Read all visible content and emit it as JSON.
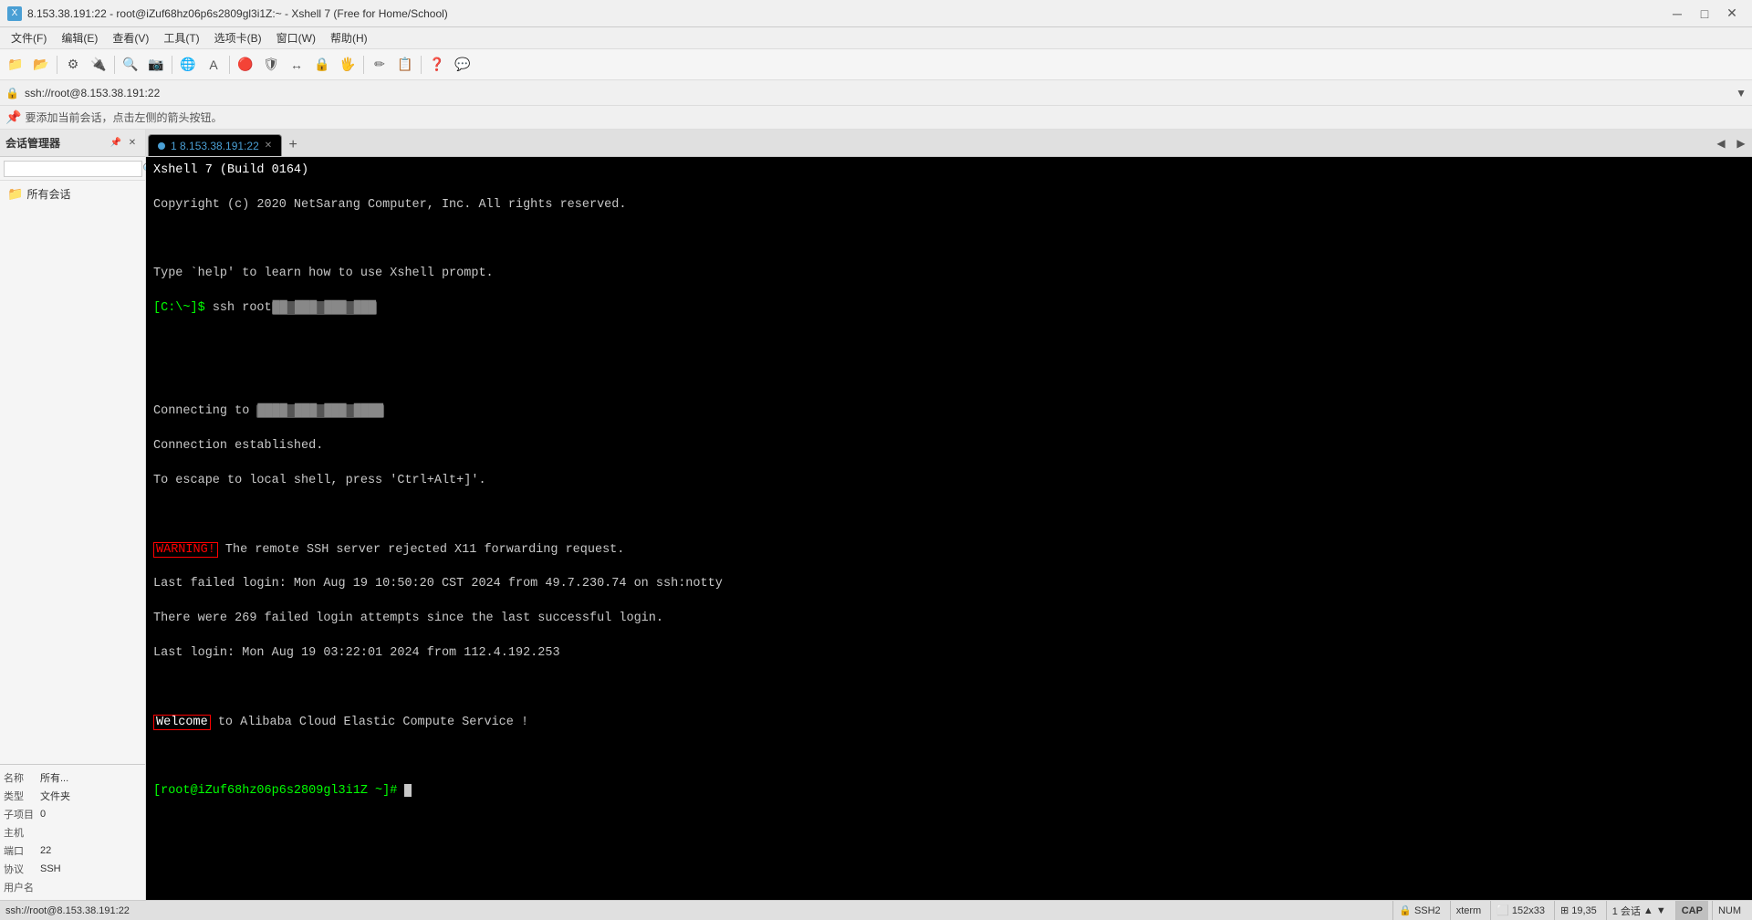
{
  "titlebar": {
    "title": "8.153.38.191:22 - root@iZuf68hz06p6s2809gl3i1Z:~ - Xshell 7 (Free for Home/School)",
    "minimize_label": "─",
    "maximize_label": "□",
    "close_label": "✕"
  },
  "menubar": {
    "items": [
      "文件(F)",
      "编辑(E)",
      "查看(V)",
      "工具(T)",
      "选项卡(B)",
      "窗口(W)",
      "帮助(H)"
    ]
  },
  "addressbar": {
    "address": "ssh://root@8.153.38.191:22",
    "lock_icon": "🔒"
  },
  "hintbar": {
    "text": "要添加当前会话，点击左侧的箭头按钮。",
    "icon": "📌"
  },
  "sidebar": {
    "title": "会话管理器",
    "all_sessions_label": "所有会话",
    "search_placeholder": "",
    "props": {
      "name_label": "名称",
      "name_value": "所有...",
      "type_label": "类型",
      "type_value": "文件夹",
      "subitem_label": "子项目",
      "subitem_value": "0",
      "host_label": "主机",
      "host_value": "",
      "port_label": "端口",
      "port_value": "22",
      "protocol_label": "协议",
      "protocol_value": "SSH",
      "username_label": "用户名",
      "username_value": ""
    }
  },
  "tabs": {
    "active_tab": {
      "label": "1 8.153.38.191:22",
      "dot_color": "#4a9fd4"
    },
    "add_label": "+"
  },
  "terminal": {
    "lines": [
      {
        "id": "l1",
        "text": "Xshell 7 (Build 0164)",
        "color": "white"
      },
      {
        "id": "l2",
        "text": "Copyright (c) 2020 NetSarang Computer, Inc. All rights reserved.",
        "color": "normal"
      },
      {
        "id": "l3",
        "text": "",
        "color": "normal"
      },
      {
        "id": "l4",
        "text": "Type `help' to learn how to use Xshell prompt.",
        "color": "normal"
      },
      {
        "id": "l5",
        "text": "[C:\\~]$ ssh root@BLURRED",
        "color": "green_prompt"
      },
      {
        "id": "l6",
        "text": "",
        "color": "normal"
      },
      {
        "id": "l7",
        "text": "",
        "color": "normal"
      },
      {
        "id": "l8",
        "text": "Connecting to BLURRED_IP",
        "color": "normal"
      },
      {
        "id": "l9",
        "text": "Connection established.",
        "color": "normal"
      },
      {
        "id": "l10",
        "text": "To escape to local shell, press 'Ctrl+Alt+]'.",
        "color": "normal"
      },
      {
        "id": "l11",
        "text": "",
        "color": "normal"
      },
      {
        "id": "l12",
        "text": "WARNING! The remote SSH server rejected X11 forwarding request.",
        "color": "warning"
      },
      {
        "id": "l13",
        "text": "Last failed login: Mon Aug 19 10:50:20 CST 2024 from 49.7.230.74 on ssh:notty",
        "color": "normal"
      },
      {
        "id": "l14",
        "text": "There were 269 failed login attempts since the last successful login.",
        "color": "normal"
      },
      {
        "id": "l15",
        "text": "Last login: Mon Aug 19 03:22:01 2024 from 112.4.192.253",
        "color": "normal"
      },
      {
        "id": "l16",
        "text": "",
        "color": "normal"
      },
      {
        "id": "l17",
        "text": "Welcome to Alibaba Cloud Elastic Compute Service !",
        "color": "welcome"
      },
      {
        "id": "l18",
        "text": "",
        "color": "normal"
      },
      {
        "id": "l19",
        "text": "[root@iZuf68hz06p6s2809gl3i1Z ~]# ",
        "color": "prompt"
      },
      {
        "id": "l20",
        "text": "",
        "color": "normal"
      }
    ],
    "prompt_prefix": "[C:\\~]$",
    "ssh_cmd": "ssh root",
    "root_prompt": "[root@iZuf68hz06p6s2809gl3i1Z ~]#"
  },
  "statusbar": {
    "path": "ssh://root@8.153.38.191:22",
    "protocol": "SSH2",
    "terminal_type": "xterm",
    "size": "152x33",
    "position": "19,35",
    "sessions": "1 会话",
    "arrow_up": "▲",
    "arrow_down": "▼",
    "cap_label": "CAP",
    "num_label": "NUM"
  }
}
